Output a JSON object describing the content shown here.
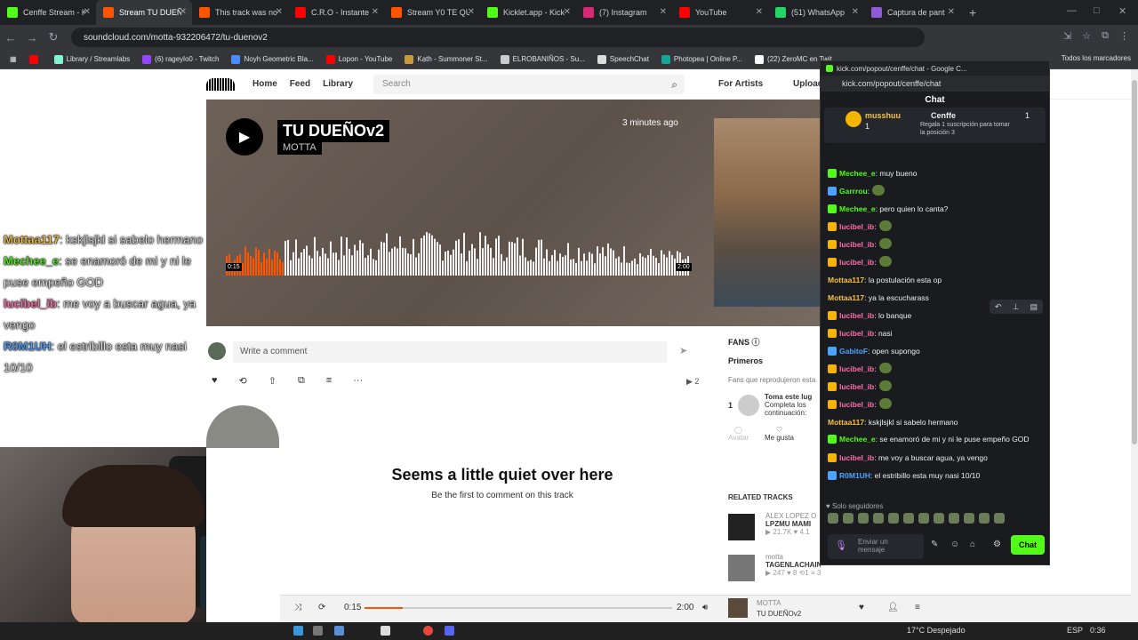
{
  "browser": {
    "tabs": [
      {
        "title": "Cenffe Stream - K",
        "color": "#53fc18",
        "active": false
      },
      {
        "title": "Stream TU DUEÑ",
        "color": "#ff5500",
        "active": true
      },
      {
        "title": "This track was no",
        "color": "#ff5500",
        "active": false
      },
      {
        "title": "C.R.O - Instante",
        "color": "#ff0000",
        "active": false
      },
      {
        "title": "Stream Y0 TE QU",
        "color": "#ff5500",
        "active": false
      },
      {
        "title": "Kicklet.app - Kick",
        "color": "#53fc18",
        "active": false
      },
      {
        "title": "(7) Instagram",
        "color": "#d62976",
        "active": false
      },
      {
        "title": "YouTube",
        "color": "#ff0000",
        "active": false
      },
      {
        "title": "(51) WhatsApp",
        "color": "#25d366",
        "active": false
      },
      {
        "title": "Captura de pant",
        "color": "#8e5bd6",
        "active": false
      }
    ],
    "url": "soundcloud.com/motta-932206472/tu-duenov2",
    "bookmarks": [
      {
        "label": "",
        "color": "#ff0000"
      },
      {
        "label": "Library / Streamlabs",
        "color": "#80f5d2"
      },
      {
        "label": "(6) rageylo0 - Twitch",
        "color": "#9146ff"
      },
      {
        "label": "Noyh Geometric Bla...",
        "color": "#4a8cff"
      },
      {
        "label": "Lopon - YouTube",
        "color": "#ff0000"
      },
      {
        "label": "Kạth - Summoner St...",
        "color": "#c89b3c"
      },
      {
        "label": "ELROBANIÑOS - Su...",
        "color": "#cccccc"
      },
      {
        "label": "SpeechChat",
        "color": "#dddddd"
      },
      {
        "label": "Photopea | Online P...",
        "color": "#18a497"
      },
      {
        "label": "(22) ZeroMC en Twit...",
        "color": "#ffffff"
      }
    ],
    "all_bookmarks": "Todos los marcadores"
  },
  "stream_chat": [
    {
      "user": "Mottaa117",
      "text": ": kskjlsjkl si sabelo hermano",
      "color": "#f5c04a"
    },
    {
      "user": "Mechee_e",
      "text": ": se enamoró de mi y ni le puse empeño GOD",
      "color": "#53fc18"
    },
    {
      "user": "lucibel_ib",
      "text": ": me voy a buscar agua, ya vengo",
      "color": "#ff6fa8"
    },
    {
      "user": "R0M1UH",
      "text": ": el estribillo esta muy nasi 10/10",
      "color": "#4fa3ff"
    }
  ],
  "soundcloud": {
    "nav": {
      "home": "Home",
      "feed": "Feed",
      "library": "Library",
      "search_placeholder": "Search",
      "for_artists": "For Artists",
      "upload": "Upload"
    },
    "track": {
      "title": "TU DUEÑOv2",
      "artist": "MOTTA",
      "posted": "3 minutes ago",
      "pos": "0:15",
      "dur": "2:00",
      "progress": 0.125
    },
    "comment_placeholder": "Write a comment",
    "plays": "2",
    "quiet_title": "Seems a little quiet over here",
    "quiet_sub": "Be the first to comment on this track",
    "fans": {
      "header": "FANS",
      "tab": "Primeros",
      "desc": "Fans que reprodujeron esta",
      "rank": "1",
      "fan_title": "Toma este lug",
      "fan_line1": "Completa los",
      "fan_line2": "continuación:",
      "avatar_label": "Avatar",
      "like_label": "Me gusta"
    },
    "related": {
      "header": "RELATED TRACKS",
      "items": [
        {
          "artist": "ALEX LOPEZ O",
          "title": "LPZMU MAMI",
          "stats": "▶ 21.7K ♥ 4.1"
        },
        {
          "artist": "motta",
          "title": "TAGENLACHAIN",
          "stats": "▶ 247 ♥ 8 ⟲1 ≡ 3"
        }
      ]
    },
    "player": {
      "pos": "0:15",
      "dur": "2:00",
      "artist": "MOTTA",
      "title": "TU DUEÑOv2"
    }
  },
  "kick": {
    "window_title": "kick.com/popout/cenffe/chat - Google C...",
    "url": "kick.com/popout/cenffe/chat",
    "chat_header": "Chat",
    "pinned": {
      "user": "musshuu",
      "count": "1",
      "channel": "Cenffe",
      "line1": "Regala 1 suscripción para tomar",
      "line2": "la posición 3",
      "right_count": "1"
    },
    "messages": [
      {
        "user": "Mechee_e",
        "text": ": muy bueno",
        "color": "#53fc18",
        "badge": "#53fc18",
        "emote": false
      },
      {
        "user": "Garrrou",
        "text": ":",
        "color": "#53fc18",
        "badge": "#4aa3ff",
        "emote": true
      },
      {
        "user": "Mechee_e",
        "text": ": pero quien lo canta?",
        "color": "#53fc18",
        "badge": "#53fc18",
        "emote": false
      },
      {
        "user": "lucibel_ib",
        "text": ":",
        "color": "#ff6fa8",
        "badge": "#f5b400",
        "emote": true
      },
      {
        "user": "lucibel_ib",
        "text": ":",
        "color": "#ff6fa8",
        "badge": "#f5b400",
        "emote": true
      },
      {
        "user": "lucibel_ib",
        "text": ":",
        "color": "#ff6fa8",
        "badge": "#f5b400",
        "emote": true
      },
      {
        "user": "Mottaa117",
        "text": ": la postulación esta op",
        "color": "#f5c04a",
        "badge": "",
        "emote": false
      },
      {
        "user": "Mottaa117",
        "text": ": ya la escucharass",
        "color": "#f5c04a",
        "badge": "",
        "emote": false
      },
      {
        "user": "lucibel_ib",
        "text": ": lo banque",
        "color": "#ff6fa8",
        "badge": "#f5b400",
        "emote": false
      },
      {
        "user": "lucibel_ib",
        "text": ": nasi",
        "color": "#ff6fa8",
        "badge": "#f5b400",
        "emote": false
      },
      {
        "user": "GabitoF",
        "text": ": open supongo",
        "color": "#4fa3ff",
        "badge": "#4aa3ff",
        "emote": false
      },
      {
        "user": "lucibel_ib",
        "text": ":",
        "color": "#ff6fa8",
        "badge": "#f5b400",
        "emote": true
      },
      {
        "user": "lucibel_ib",
        "text": ":",
        "color": "#ff6fa8",
        "badge": "#f5b400",
        "emote": true
      },
      {
        "user": "lucibel_ib",
        "text": ":",
        "color": "#ff6fa8",
        "badge": "#f5b400",
        "emote": true
      },
      {
        "user": "Mottaa117",
        "text": ": kskjlsjkl si sabelo hermano",
        "color": "#f5c04a",
        "badge": "",
        "emote": false
      },
      {
        "user": "Mechee_e",
        "text": ": se enamoró de mi y ni le puse empeño GOD",
        "color": "#53fc18",
        "badge": "#53fc18",
        "emote": false
      },
      {
        "user": "lucibel_ib",
        "text": ": me voy a buscar agua, ya vengo",
        "color": "#ff6fa8",
        "badge": "#f5b400",
        "emote": false
      },
      {
        "user": "R0M1UH",
        "text": ": el estribillo esta muy nasi 10/10",
        "color": "#4fa3ff",
        "badge": "#4aa3ff",
        "emote": false
      }
    ],
    "solo": "Solo seguidores",
    "input_placeholder": "Enviar un mensaje",
    "chat_button": "Chat"
  },
  "taskbar": {
    "weather": "17°C Despejado",
    "lang": "ESP",
    "time": "0:36"
  }
}
